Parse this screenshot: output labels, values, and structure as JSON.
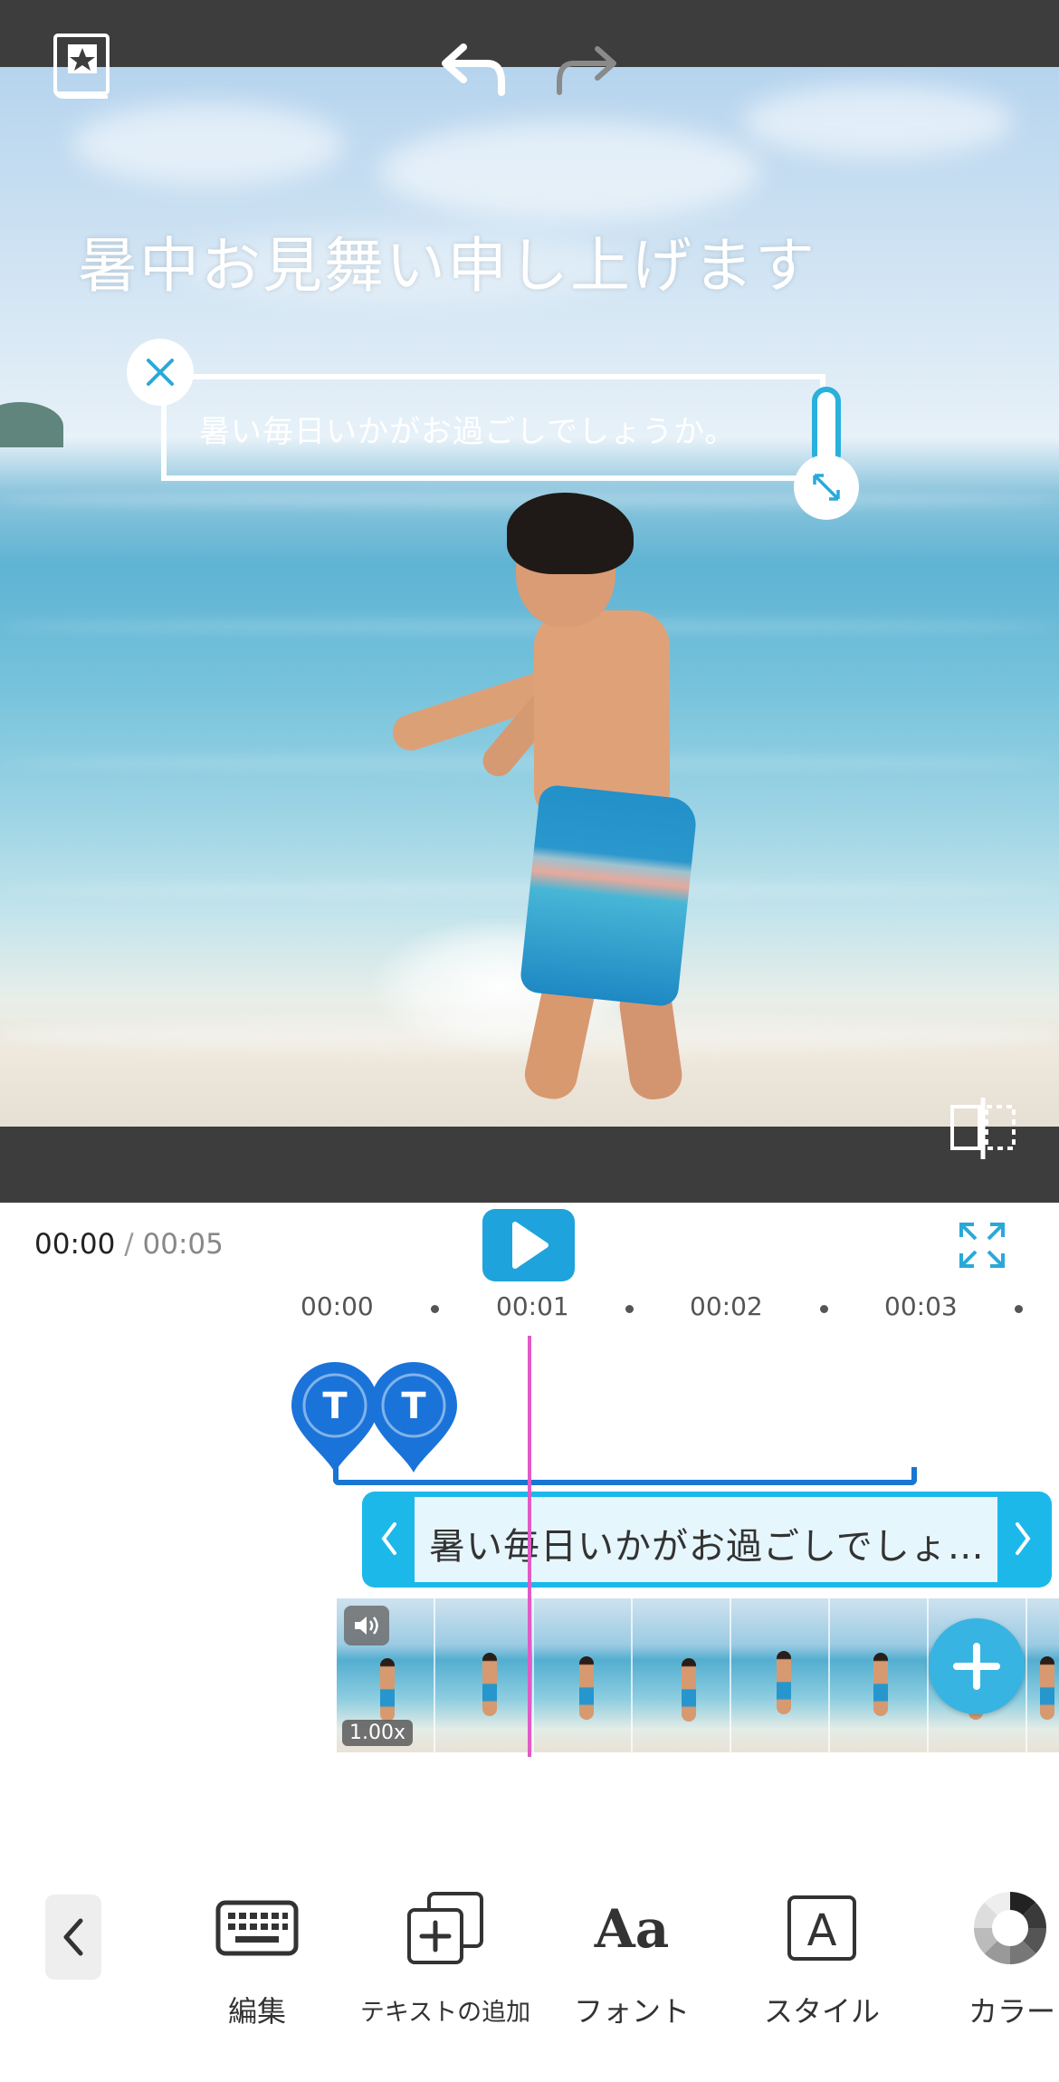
{
  "preview": {
    "title_text": "暑中お見舞い申し上げます",
    "selected_text": "暑い毎日いかがお過ごしでしょうか。"
  },
  "player": {
    "current_time": "00:00",
    "separator": " / ",
    "total_time": "00:05"
  },
  "timeline": {
    "ticks": [
      "00:00",
      "00:01",
      "00:02",
      "00:03"
    ],
    "markers": [
      "T",
      "T"
    ],
    "text_clip_label": "暑い毎日いかがお過ごしでしょ…",
    "speed": "1.00x"
  },
  "toolbar": {
    "items": [
      {
        "label": "編集",
        "icon": "keyboard-icon"
      },
      {
        "label": "テキストの追加",
        "icon": "add-text-icon"
      },
      {
        "label": "フォント",
        "icon": "font-icon"
      },
      {
        "label": "スタイル",
        "icon": "style-icon"
      },
      {
        "label": "カラー",
        "icon": "color-icon"
      }
    ]
  },
  "colors": {
    "accent": "#1fa3dc",
    "marker": "#1a73d9",
    "playhead": "#e15bc6",
    "text_clip": "#1cb8ea"
  }
}
